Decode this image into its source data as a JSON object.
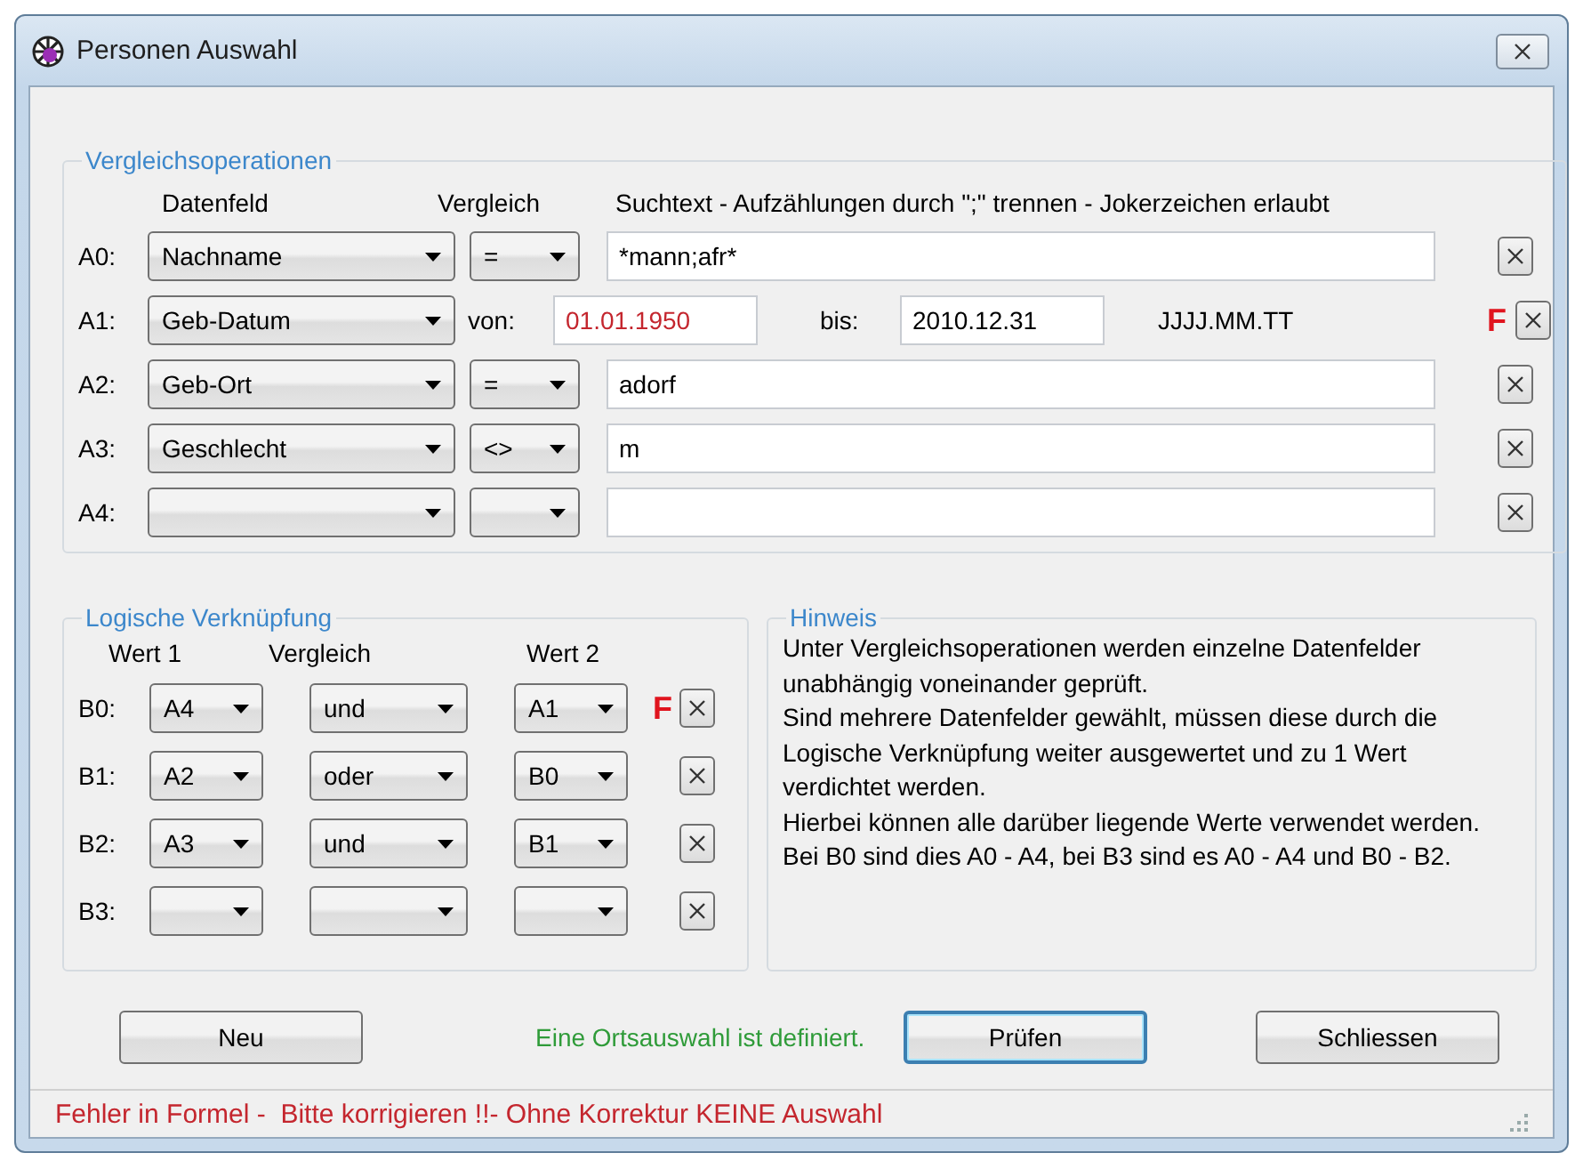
{
  "window": {
    "title": "Personen Auswahl"
  },
  "comparisons": {
    "title": "Vergleichsoperationen",
    "headers": [
      "Datenfeld",
      "Vergleich",
      "Suchtext - Aufzählungen durch \";\" trennen - Jokerzeichen erlaubt"
    ],
    "rows": [
      {
        "kind": "match",
        "label": "A0:",
        "field": "Nachname",
        "operator": "=",
        "text": "*mann;afr*"
      },
      {
        "kind": "range",
        "label": "A1:",
        "field": "Geb-Datum",
        "from_label": "von:",
        "from": "01.01.1950",
        "from_invalid": true,
        "to_label": "bis:",
        "to": "2010.12.31",
        "to_invalid": false,
        "format": "JJJJ.MM.TT",
        "error_mark": "F"
      },
      {
        "kind": "match",
        "label": "A2:",
        "field": "Geb-Ort",
        "operator": "=",
        "text": "adorf"
      },
      {
        "kind": "match",
        "label": "A3:",
        "field": "Geschlecht",
        "operator": "<>",
        "text": "m"
      },
      {
        "kind": "match",
        "label": "A4:"
      }
    ]
  },
  "logic": {
    "title": "Logische Verknüpfung",
    "headers": [
      "Wert 1",
      "Vergleich",
      "Wert 2"
    ],
    "rows": [
      {
        "label": "B0:",
        "value1": "A4",
        "operator": "und",
        "value2": "A1",
        "error_mark": "F"
      },
      {
        "label": "B1:",
        "value1": "A2",
        "operator": "oder",
        "value2": "B0"
      },
      {
        "label": "B2:",
        "value1": "A3",
        "operator": "und",
        "value2": "B1"
      },
      {
        "label": "B3:"
      }
    ]
  },
  "hint": {
    "title": "Hinweis",
    "paragraphs": [
      "Unter Vergleichsoperationen werden einzelne Datenfelder unabhängig voneinander geprüft.",
      "Sind mehrere Datenfelder gewählt, müssen diese durch die Logische Verknüpfung weiter ausgewertet und zu 1 Wert verdichtet werden.",
      "Hierbei können alle darüber liegende Werte verwendet werden. Bei B0 sind dies A0 - A4, bei B3 sind es A0 - A4 und B0 - B2."
    ]
  },
  "actions": [
    {
      "kind": "button",
      "label": "Neu",
      "default": false
    },
    {
      "kind": "notice",
      "text": "Eine Ortsauswahl ist definiert."
    },
    {
      "kind": "button",
      "label": "Prüfen",
      "default": true
    },
    {
      "kind": "button",
      "label": "Schliessen",
      "default": false
    }
  ],
  "status_bar": {
    "text": "Fehler in Formel -  Bitte korrigieren !!- Ohne Korrektur KEINE Auswahl"
  }
}
